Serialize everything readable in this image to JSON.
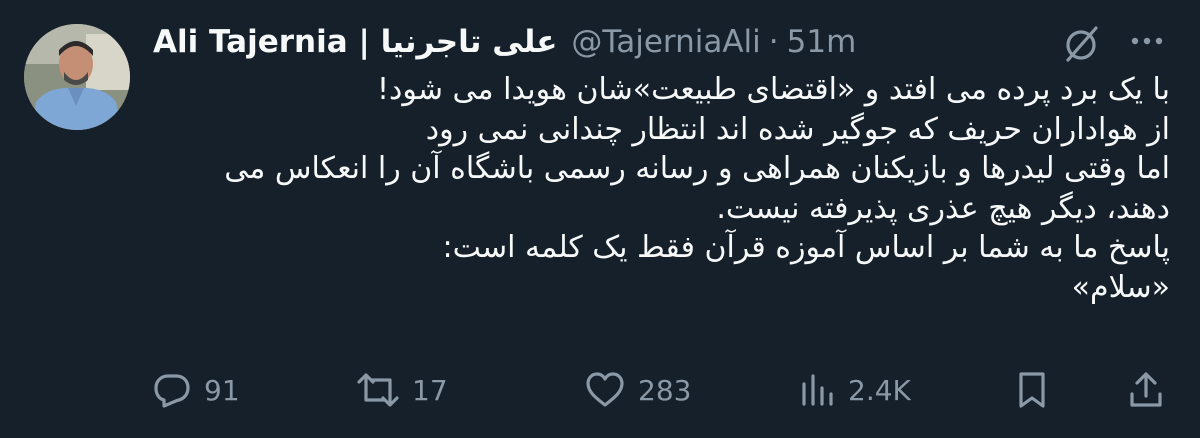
{
  "tweet": {
    "author": {
      "display_name": "Ali Tajernia | علی تاجرنیا",
      "handle": "@TajerniaAli",
      "separator": "·",
      "time": "51m"
    },
    "text_lines": [
      "با یک برد پرده می افتد و «اقتضای طبیعت»شان هویدا می شود!",
      "از هواداران حریف که جوگیر شده اند انتظار چندانی نمی رود",
      "اما وقتی لیدرها و بازیکنان همراهی و رسانه رسمی باشگاه آن را انعکاس می",
      "دهند، دیگر هیچ عذری پذیرفته نیست.",
      "پاسخ ما به شما بر اساس آموزه قرآن فقط یک کلمه است:",
      "«سلام»"
    ],
    "actions": {
      "replies": "91",
      "retweets": "17",
      "likes": "283",
      "views": "2.4K"
    },
    "icons": {
      "header": [
        "avatar",
        "grok-icon",
        "more-icon"
      ],
      "action_bar": [
        "reply-icon",
        "retweet-icon",
        "like-icon",
        "views-icon",
        "bookmark-icon",
        "share-icon"
      ]
    }
  },
  "colors": {
    "background": "#15202b",
    "text_primary": "#f7f9f9",
    "text_secondary": "#8b98a5"
  }
}
